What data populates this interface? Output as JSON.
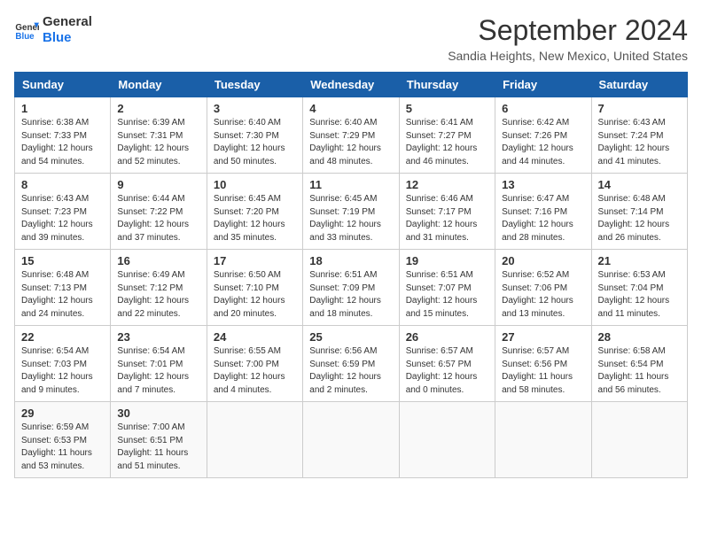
{
  "logo": {
    "line1": "General",
    "line2": "Blue"
  },
  "title": "September 2024",
  "subtitle": "Sandia Heights, New Mexico, United States",
  "days_of_week": [
    "Sunday",
    "Monday",
    "Tuesday",
    "Wednesday",
    "Thursday",
    "Friday",
    "Saturday"
  ],
  "weeks": [
    [
      {
        "day": "1",
        "detail": "Sunrise: 6:38 AM\nSunset: 7:33 PM\nDaylight: 12 hours\nand 54 minutes."
      },
      {
        "day": "2",
        "detail": "Sunrise: 6:39 AM\nSunset: 7:31 PM\nDaylight: 12 hours\nand 52 minutes."
      },
      {
        "day": "3",
        "detail": "Sunrise: 6:40 AM\nSunset: 7:30 PM\nDaylight: 12 hours\nand 50 minutes."
      },
      {
        "day": "4",
        "detail": "Sunrise: 6:40 AM\nSunset: 7:29 PM\nDaylight: 12 hours\nand 48 minutes."
      },
      {
        "day": "5",
        "detail": "Sunrise: 6:41 AM\nSunset: 7:27 PM\nDaylight: 12 hours\nand 46 minutes."
      },
      {
        "day": "6",
        "detail": "Sunrise: 6:42 AM\nSunset: 7:26 PM\nDaylight: 12 hours\nand 44 minutes."
      },
      {
        "day": "7",
        "detail": "Sunrise: 6:43 AM\nSunset: 7:24 PM\nDaylight: 12 hours\nand 41 minutes."
      }
    ],
    [
      {
        "day": "8",
        "detail": "Sunrise: 6:43 AM\nSunset: 7:23 PM\nDaylight: 12 hours\nand 39 minutes."
      },
      {
        "day": "9",
        "detail": "Sunrise: 6:44 AM\nSunset: 7:22 PM\nDaylight: 12 hours\nand 37 minutes."
      },
      {
        "day": "10",
        "detail": "Sunrise: 6:45 AM\nSunset: 7:20 PM\nDaylight: 12 hours\nand 35 minutes."
      },
      {
        "day": "11",
        "detail": "Sunrise: 6:45 AM\nSunset: 7:19 PM\nDaylight: 12 hours\nand 33 minutes."
      },
      {
        "day": "12",
        "detail": "Sunrise: 6:46 AM\nSunset: 7:17 PM\nDaylight: 12 hours\nand 31 minutes."
      },
      {
        "day": "13",
        "detail": "Sunrise: 6:47 AM\nSunset: 7:16 PM\nDaylight: 12 hours\nand 28 minutes."
      },
      {
        "day": "14",
        "detail": "Sunrise: 6:48 AM\nSunset: 7:14 PM\nDaylight: 12 hours\nand 26 minutes."
      }
    ],
    [
      {
        "day": "15",
        "detail": "Sunrise: 6:48 AM\nSunset: 7:13 PM\nDaylight: 12 hours\nand 24 minutes."
      },
      {
        "day": "16",
        "detail": "Sunrise: 6:49 AM\nSunset: 7:12 PM\nDaylight: 12 hours\nand 22 minutes."
      },
      {
        "day": "17",
        "detail": "Sunrise: 6:50 AM\nSunset: 7:10 PM\nDaylight: 12 hours\nand 20 minutes."
      },
      {
        "day": "18",
        "detail": "Sunrise: 6:51 AM\nSunset: 7:09 PM\nDaylight: 12 hours\nand 18 minutes."
      },
      {
        "day": "19",
        "detail": "Sunrise: 6:51 AM\nSunset: 7:07 PM\nDaylight: 12 hours\nand 15 minutes."
      },
      {
        "day": "20",
        "detail": "Sunrise: 6:52 AM\nSunset: 7:06 PM\nDaylight: 12 hours\nand 13 minutes."
      },
      {
        "day": "21",
        "detail": "Sunrise: 6:53 AM\nSunset: 7:04 PM\nDaylight: 12 hours\nand 11 minutes."
      }
    ],
    [
      {
        "day": "22",
        "detail": "Sunrise: 6:54 AM\nSunset: 7:03 PM\nDaylight: 12 hours\nand 9 minutes."
      },
      {
        "day": "23",
        "detail": "Sunrise: 6:54 AM\nSunset: 7:01 PM\nDaylight: 12 hours\nand 7 minutes."
      },
      {
        "day": "24",
        "detail": "Sunrise: 6:55 AM\nSunset: 7:00 PM\nDaylight: 12 hours\nand 4 minutes."
      },
      {
        "day": "25",
        "detail": "Sunrise: 6:56 AM\nSunset: 6:59 PM\nDaylight: 12 hours\nand 2 minutes."
      },
      {
        "day": "26",
        "detail": "Sunrise: 6:57 AM\nSunset: 6:57 PM\nDaylight: 12 hours\nand 0 minutes."
      },
      {
        "day": "27",
        "detail": "Sunrise: 6:57 AM\nSunset: 6:56 PM\nDaylight: 11 hours\nand 58 minutes."
      },
      {
        "day": "28",
        "detail": "Sunrise: 6:58 AM\nSunset: 6:54 PM\nDaylight: 11 hours\nand 56 minutes."
      }
    ],
    [
      {
        "day": "29",
        "detail": "Sunrise: 6:59 AM\nSunset: 6:53 PM\nDaylight: 11 hours\nand 53 minutes."
      },
      {
        "day": "30",
        "detail": "Sunrise: 7:00 AM\nSunset: 6:51 PM\nDaylight: 11 hours\nand 51 minutes."
      },
      {
        "day": "",
        "detail": ""
      },
      {
        "day": "",
        "detail": ""
      },
      {
        "day": "",
        "detail": ""
      },
      {
        "day": "",
        "detail": ""
      },
      {
        "day": "",
        "detail": ""
      }
    ]
  ]
}
